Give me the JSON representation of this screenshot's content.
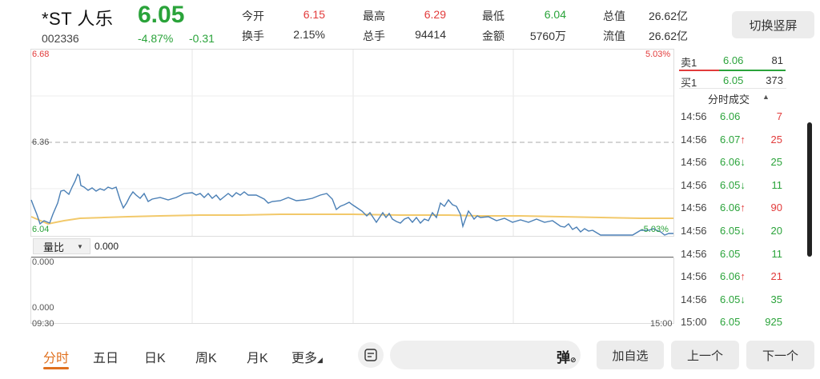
{
  "header": {
    "name": "*ST 人乐",
    "code": "002336",
    "price": "6.05",
    "change_pct": "-4.87%",
    "change_abs": "-0.31",
    "switch_label": "切换竖屏"
  },
  "stats": {
    "open_label": "今开",
    "open": "6.15",
    "turnover_label": "换手",
    "turnover": "2.15%",
    "high_label": "最高",
    "high": "6.29",
    "volume_label": "总手",
    "volume": "94414",
    "low_label": "最低",
    "low": "6.04",
    "amount_label": "金额",
    "amount": "5760万",
    "mktcap_label": "总值",
    "mktcap": "26.62亿",
    "float_label": "流值",
    "float": "26.62亿"
  },
  "chart": {
    "y_top": "6.68",
    "y_mid": "6.36",
    "y_bottom": "6.04",
    "pct_top": "5.03%",
    "pct_bottom": "-5.03%",
    "indicator_label": "量比",
    "indicator_value": "0.000",
    "sub_top": "0.000",
    "sub_bottom": "0.000",
    "time_start": "09:30",
    "time_end": "15:00"
  },
  "chart_data": {
    "type": "line",
    "ylim": [
      6.04,
      6.68
    ],
    "reference_price": 6.36,
    "series": [],
    "x_labels": [
      "09:30",
      "15:00"
    ]
  },
  "orderbook": {
    "sell1_label": "卖1",
    "sell1_price": "6.06",
    "sell1_vol": "81",
    "buy1_label": "买1",
    "buy1_price": "6.05",
    "buy1_vol": "373",
    "trades_title": "分时成交"
  },
  "trades": [
    {
      "time": "14:56",
      "price": "6.06",
      "arrow": "",
      "vol": "7",
      "pc": "green",
      "vc": "red"
    },
    {
      "time": "14:56",
      "price": "6.07",
      "arrow": "↑",
      "vol": "25",
      "pc": "green",
      "vc": "red"
    },
    {
      "time": "14:56",
      "price": "6.06",
      "arrow": "↓",
      "vol": "25",
      "pc": "green",
      "vc": "green"
    },
    {
      "time": "14:56",
      "price": "6.05",
      "arrow": "↓",
      "vol": "11",
      "pc": "green",
      "vc": "green"
    },
    {
      "time": "14:56",
      "price": "6.06",
      "arrow": "↑",
      "vol": "90",
      "pc": "green",
      "vc": "red"
    },
    {
      "time": "14:56",
      "price": "6.05",
      "arrow": "↓",
      "vol": "20",
      "pc": "green",
      "vc": "green"
    },
    {
      "time": "14:56",
      "price": "6.05",
      "arrow": "",
      "vol": "11",
      "pc": "green",
      "vc": "green"
    },
    {
      "time": "14:56",
      "price": "6.06",
      "arrow": "↑",
      "vol": "21",
      "pc": "green",
      "vc": "red"
    },
    {
      "time": "14:56",
      "price": "6.05",
      "arrow": "↓",
      "vol": "35",
      "pc": "green",
      "vc": "green"
    },
    {
      "time": "15:00",
      "price": "6.05",
      "arrow": "",
      "vol": "925",
      "pc": "green",
      "vc": "green"
    }
  ],
  "toolbar": {
    "tab_minute": "分时",
    "tab_5day": "五日",
    "tab_day": "日K",
    "tab_week": "周K",
    "tab_month": "月K",
    "tab_more": "更多",
    "bullet_label": "弹",
    "add_watch": "加自选",
    "prev": "上一个",
    "next": "下一个"
  },
  "colors": {
    "up": "#e23b3b",
    "down": "#2aa33a",
    "price_line": "#4a7fb5",
    "avg_line": "#f2c96b",
    "accent": "#e0701e"
  }
}
